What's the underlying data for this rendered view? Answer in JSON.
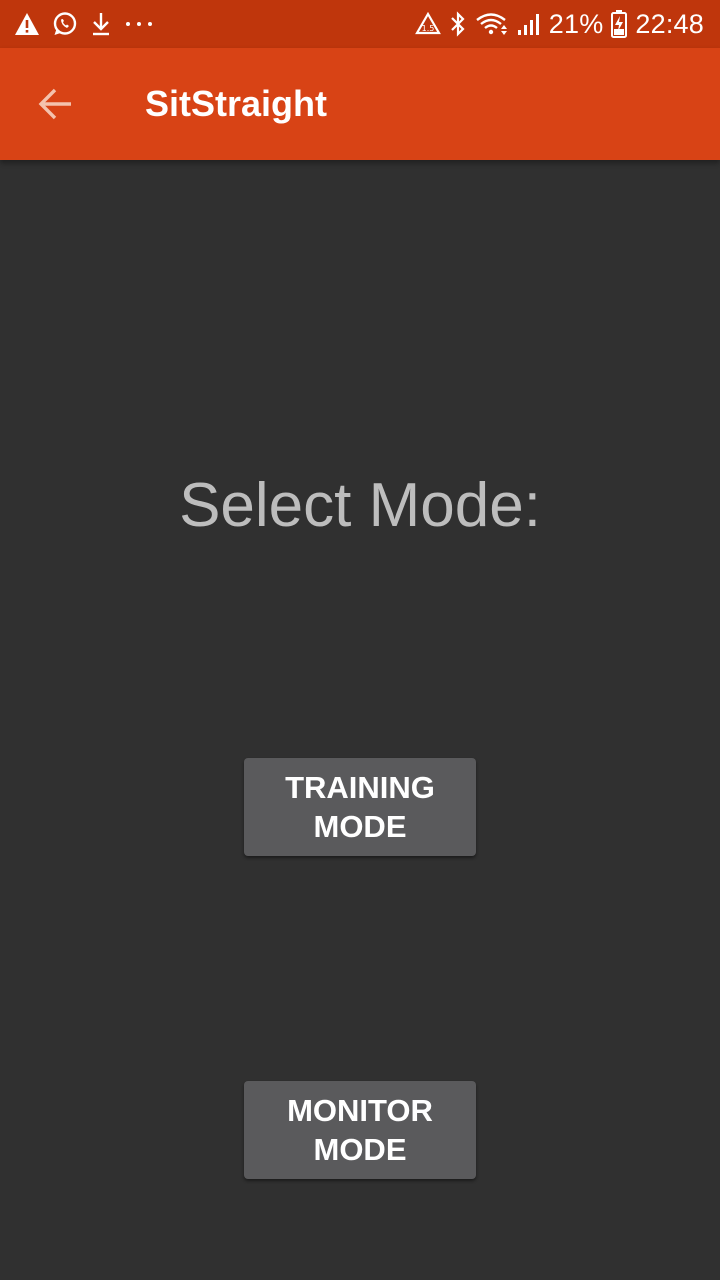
{
  "status_bar": {
    "battery_percent": "21%",
    "time": "22:48",
    "left_icons": [
      "warning-icon",
      "whatsapp-icon",
      "download-icon",
      "more-dots-icon"
    ],
    "right_icons": [
      "data-saver-icon",
      "bluetooth-icon",
      "wifi-icon",
      "signal-icon",
      "battery-charging-icon"
    ]
  },
  "app_bar": {
    "title": "SitStraight",
    "back_icon": "arrow-back-icon"
  },
  "main": {
    "heading": "Select Mode:",
    "buttons": [
      {
        "line1": "TRAINING",
        "line2": "MODE"
      },
      {
        "line1": "MONITOR",
        "line2": "MODE"
      }
    ]
  },
  "colors": {
    "status_bar": "#bf360c",
    "app_bar": "#d84315",
    "background": "#303030",
    "button": "#5a5a5c",
    "heading_text": "#bdbdbd"
  }
}
